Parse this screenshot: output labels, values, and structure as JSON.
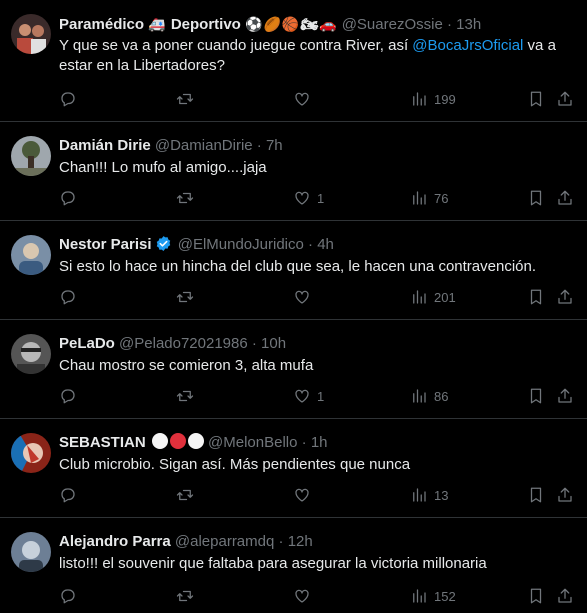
{
  "tweets": [
    {
      "name": "Paramédico",
      "name_suffix": "Deportivo",
      "emoji_before": "🚑",
      "emoji_after": "⚽🏉🏀🏍🚗",
      "handle": "@SuarezOssie",
      "sep": "·",
      "time": "13h",
      "text_pre": "Y que se va a poner cuando juegue contra River, así ",
      "mention": "@BocaJrsOficial",
      "text_post": " va a estar en la Libertadores?",
      "replies": "",
      "retweets": "",
      "likes": "",
      "views": "199",
      "avatar_colors": [
        "#3a2a2a",
        "#b94a3c"
      ]
    },
    {
      "name": "Damián Dirie",
      "handle": "@DamianDirie",
      "sep": "·",
      "time": "7h",
      "text": "Chan!!! Lo mufo al amigo....jaja",
      "replies": "",
      "retweets": "",
      "likes": "1",
      "views": "76",
      "avatar_colors": [
        "#9fa7ad",
        "#4a5a3a"
      ]
    },
    {
      "name": "Nestor Parisi",
      "verified": true,
      "handle": "@ElMundoJuridico",
      "sep": "·",
      "time": "4h",
      "text": "Si esto lo hace un hincha del club que sea, le hacen una contravención.",
      "replies": "",
      "retweets": "",
      "likes": "",
      "views": "201",
      "avatar_colors": [
        "#7a8fa6",
        "#d9c7b0"
      ]
    },
    {
      "name": "PeLaDo",
      "handle": "@Pelado72021986",
      "sep": "·",
      "time": "10h",
      "text": "Chau mostro se comieron 3, alta mufa",
      "replies": "",
      "retweets": "",
      "likes": "1",
      "views": "86",
      "avatar_colors": [
        "#555",
        "#b8b8b8"
      ]
    },
    {
      "name": "SEBASTIAN",
      "handle": "@MelonBello",
      "sep": "·",
      "time": "1h",
      "text": "Club microbio. Sigan así. Más pendientes que nunca",
      "replies": "",
      "retweets": "",
      "likes": "",
      "views": "13",
      "avatar_colors": [
        "#c0392b",
        "#1a6fb5"
      ],
      "circle_colors": [
        "#f5f5f5",
        "#e0303c",
        "#f5f5f5"
      ]
    },
    {
      "name": "Alejandro Parra",
      "handle": "@aleparramdq",
      "sep": "·",
      "time": "12h",
      "text": "listo!!! el souvenir que faltaba para asegurar la victoria millonaria",
      "replies": "",
      "retweets": "",
      "likes": "",
      "views": "152",
      "avatar_colors": [
        "#6d7f95",
        "#c7d1db"
      ]
    }
  ],
  "colors": {
    "background": "#000000",
    "text": "#e7e9ea",
    "secondary": "#71767b",
    "link": "#1d9bf0",
    "border": "#2f3336",
    "verified": "#1d9bf0"
  },
  "icons": [
    "reply-icon",
    "retweet-icon",
    "like-icon",
    "views-icon",
    "bookmark-icon",
    "share-icon"
  ]
}
